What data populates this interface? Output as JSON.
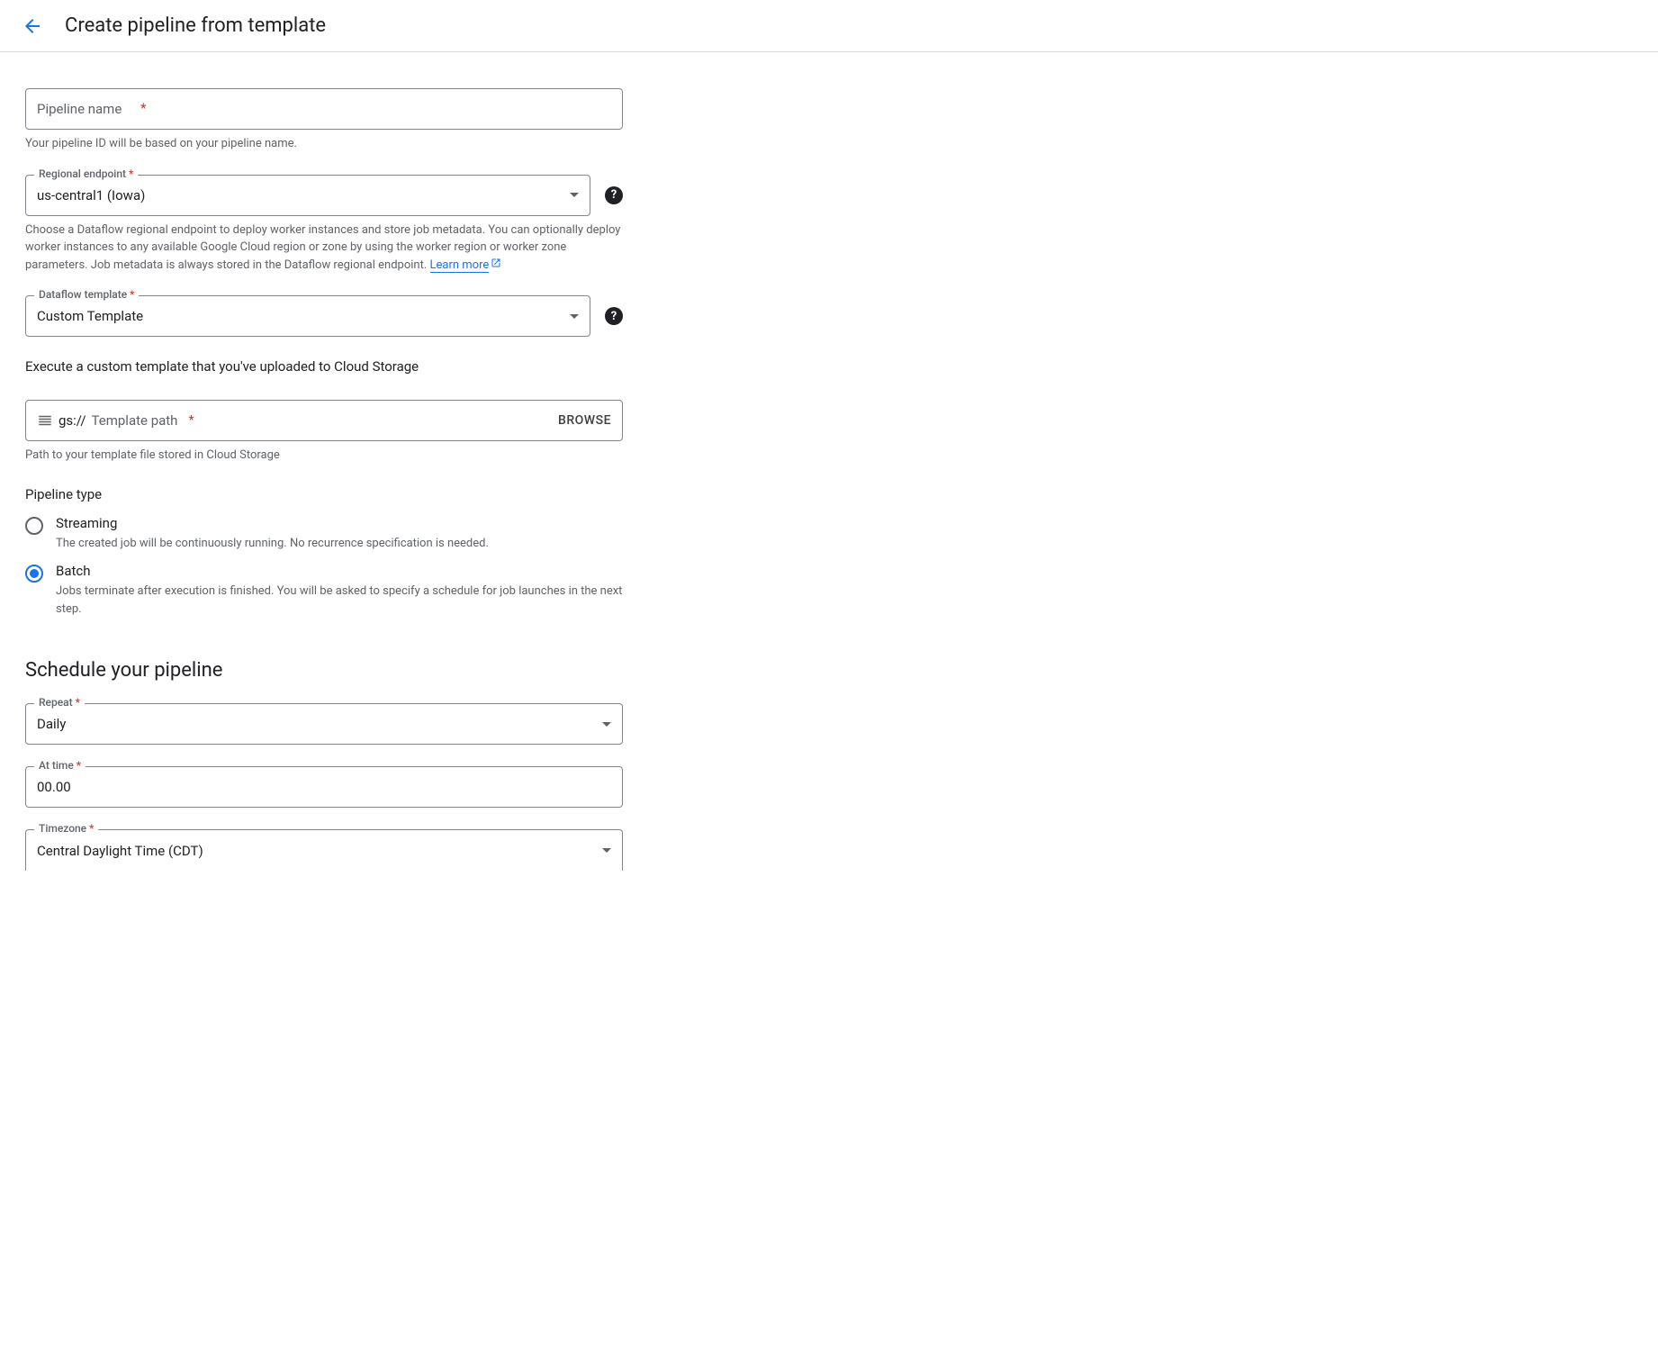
{
  "header": {
    "title": "Create pipeline from template"
  },
  "pipeline_name": {
    "placeholder": "Pipeline name",
    "helper": "Your pipeline ID will be based on your pipeline name."
  },
  "regional_endpoint": {
    "label": "Regional endpoint",
    "value": "us-central1 (Iowa)",
    "helper": "Choose a Dataflow regional endpoint to deploy worker instances and store job metadata. You can optionally deploy worker instances to any available Google Cloud region or zone by using the worker region or worker zone parameters. Job metadata is always stored in the Dataflow regional endpoint.",
    "learn_more": "Learn more"
  },
  "dataflow_template": {
    "label": "Dataflow template",
    "value": "Custom Template",
    "description": "Execute a custom template that you've uploaded to Cloud Storage"
  },
  "template_path": {
    "prefix": "gs://",
    "placeholder": "Template path",
    "browse": "BROWSE",
    "helper": "Path to your template file stored in Cloud Storage"
  },
  "pipeline_type": {
    "label": "Pipeline type",
    "options": [
      {
        "label": "Streaming",
        "desc": "The created job will be continuously running. No recurrence specification is needed.",
        "selected": false
      },
      {
        "label": "Batch",
        "desc": "Jobs terminate after execution is finished. You will be asked to specify a schedule for job launches in the next step.",
        "selected": true
      }
    ]
  },
  "schedule": {
    "heading": "Schedule your pipeline",
    "repeat": {
      "label": "Repeat",
      "value": "Daily"
    },
    "at_time": {
      "label": "At time",
      "value": "00.00"
    },
    "timezone": {
      "label": "Timezone",
      "value": "Central Daylight Time (CDT)"
    }
  }
}
